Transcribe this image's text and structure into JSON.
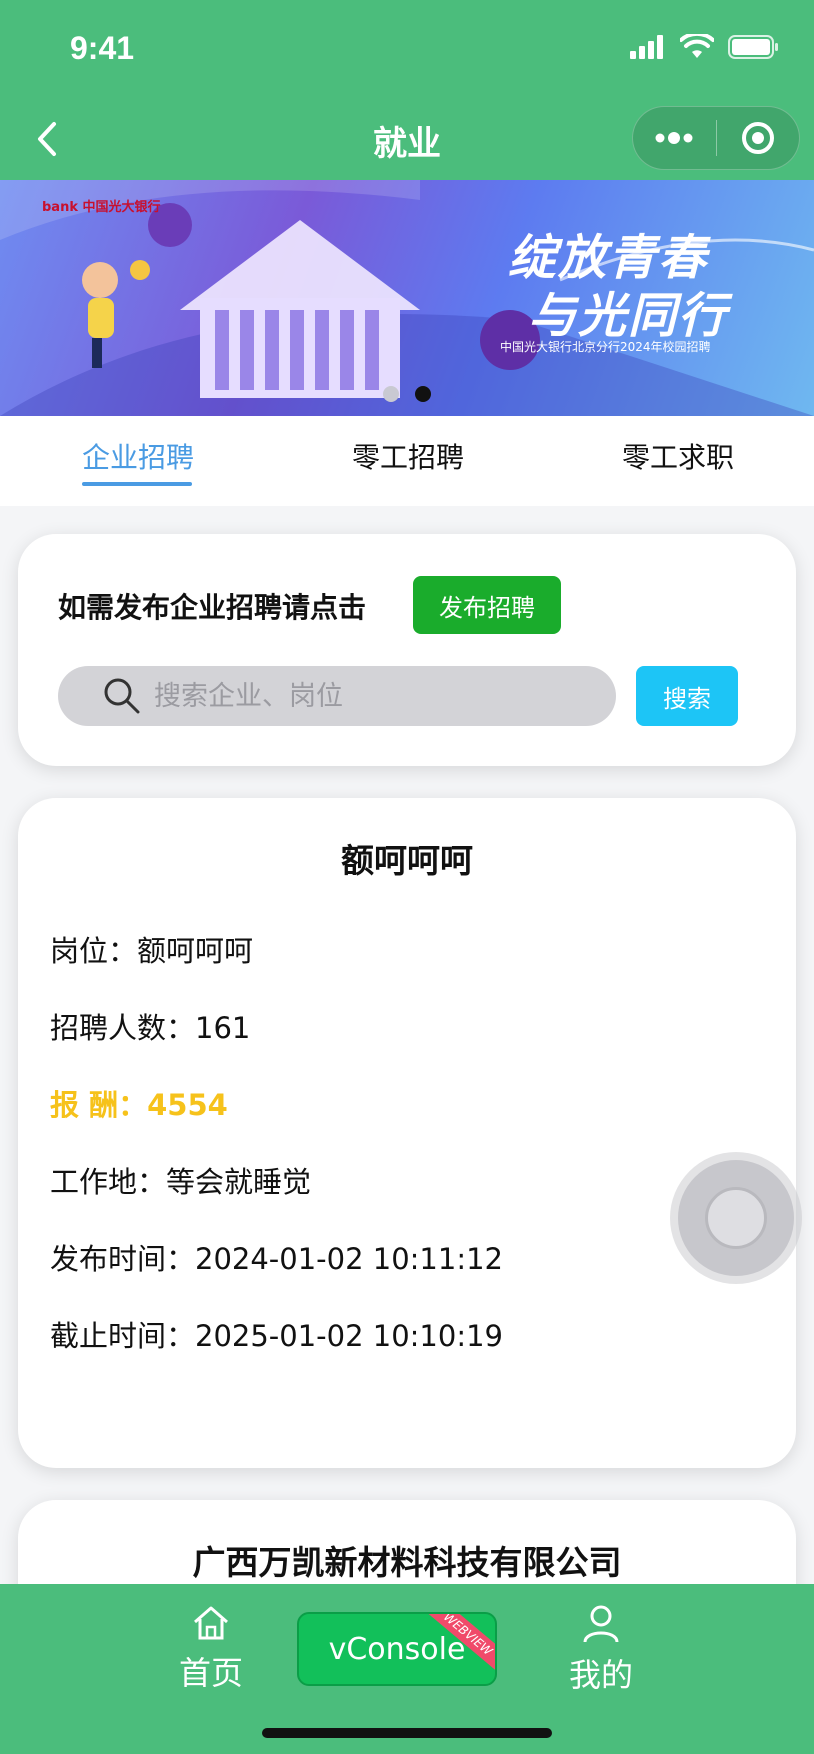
{
  "status_bar": {
    "time": "9:41"
  },
  "nav": {
    "title": "就业"
  },
  "banner": {
    "logo_text": "bank 中国光大银行",
    "slogan_line1": "绽放青春",
    "slogan_line2": "与光同行",
    "caption": "中国光大银行北京分行2024年校园招聘",
    "dot_count": 2,
    "active_dot": 2
  },
  "tabs": [
    {
      "label": "企业招聘",
      "active": true
    },
    {
      "label": "零工招聘",
      "active": false
    },
    {
      "label": "零工求职",
      "active": false
    }
  ],
  "publish": {
    "prompt": "如需发布企业招聘请点击",
    "button": "发布招聘"
  },
  "search": {
    "placeholder": "搜索企业、岗位",
    "value": "",
    "button": "搜索"
  },
  "jobs": [
    {
      "title": "额呵呵呵",
      "position": "岗位：额呵呵呵",
      "headcount": "招聘人数：161",
      "salary": "报 酬：4554",
      "location": "工作地：等会就睡觉",
      "published": "发布时间：2024-01-02 10:11:12",
      "deadline": "截止时间：2025-01-02 10:10:19"
    },
    {
      "title": "广西万凯新材料科技有限公司"
    }
  ],
  "tabbar": {
    "home": "首页",
    "vconsole": "vConsole",
    "vconsole_tag": "WEBVIEW",
    "mine": "我的"
  },
  "colors": {
    "brand_green": "#4bbd7c",
    "publish_green": "#1aac2c",
    "search_blue": "#1dc5f6",
    "tab_active": "#4a9be3",
    "salary": "#f6c21b"
  }
}
